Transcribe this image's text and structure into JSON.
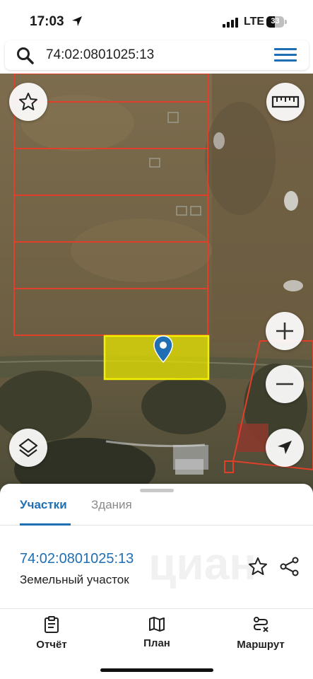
{
  "status_bar": {
    "time": "17:03",
    "network": "LTE",
    "battery": "33"
  },
  "search": {
    "value": "74:02:0801025:13"
  },
  "icons": {
    "search": "search-icon",
    "menu": "hamburger-menu-icon",
    "favorite": "star-icon",
    "ruler": "ruler-icon",
    "zoom_in": "plus-icon",
    "zoom_out": "minus-icon",
    "layers": "layers-icon",
    "locate": "navigation-arrow-icon",
    "pin": "map-pin-icon",
    "share": "share-icon",
    "report": "clipboard-icon",
    "plan": "map-icon",
    "route": "route-icon"
  },
  "colors": {
    "accent": "#1f6fb2",
    "parcel_border": "#e0402a",
    "selected_fill": "#e8e400",
    "selected_border": "#f2f200",
    "pin": "#1f6fb2"
  },
  "sheet": {
    "tabs": [
      {
        "label": "Участки",
        "active": true
      },
      {
        "label": "Здания",
        "active": false
      }
    ],
    "parcel": {
      "id": "74:02:0801025:13",
      "type": "Земельный участок"
    },
    "watermark": "циан"
  },
  "bottom_nav": [
    {
      "label": "Отчёт",
      "icon": "clipboard-icon"
    },
    {
      "label": "План",
      "icon": "map-icon"
    },
    {
      "label": "Маршрут",
      "icon": "route-icon"
    }
  ]
}
